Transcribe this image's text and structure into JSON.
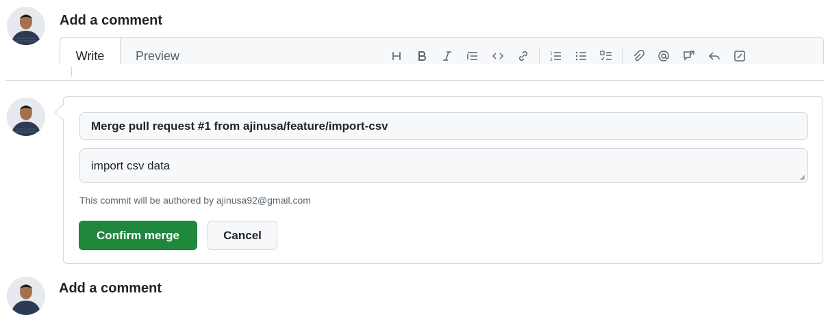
{
  "comment_section": {
    "title": "Add a comment",
    "tabs": [
      {
        "label": "Write",
        "active": true
      },
      {
        "label": "Preview",
        "active": false
      }
    ],
    "toolbar": [
      "heading-icon",
      "bold-icon",
      "italic-icon",
      "quote-icon",
      "code-icon",
      "link-icon",
      "numbered-list-icon",
      "unordered-list-icon",
      "task-list-icon",
      "attach-icon",
      "mention-icon",
      "reference-icon",
      "reply-icon",
      "slash-commands-icon"
    ]
  },
  "merge": {
    "commit_title": "Merge pull request #1 from ajinusa/feature/import-csv",
    "commit_message": "import csv data",
    "author_note": "This commit will be authored by ajinusa92@gmail.com",
    "confirm_label": "Confirm merge",
    "cancel_label": "Cancel"
  },
  "bottom_section": {
    "title": "Add a comment"
  },
  "colors": {
    "confirm_bg": "#1f883d",
    "border": "#d0d7de",
    "muted_text": "#59636e"
  }
}
